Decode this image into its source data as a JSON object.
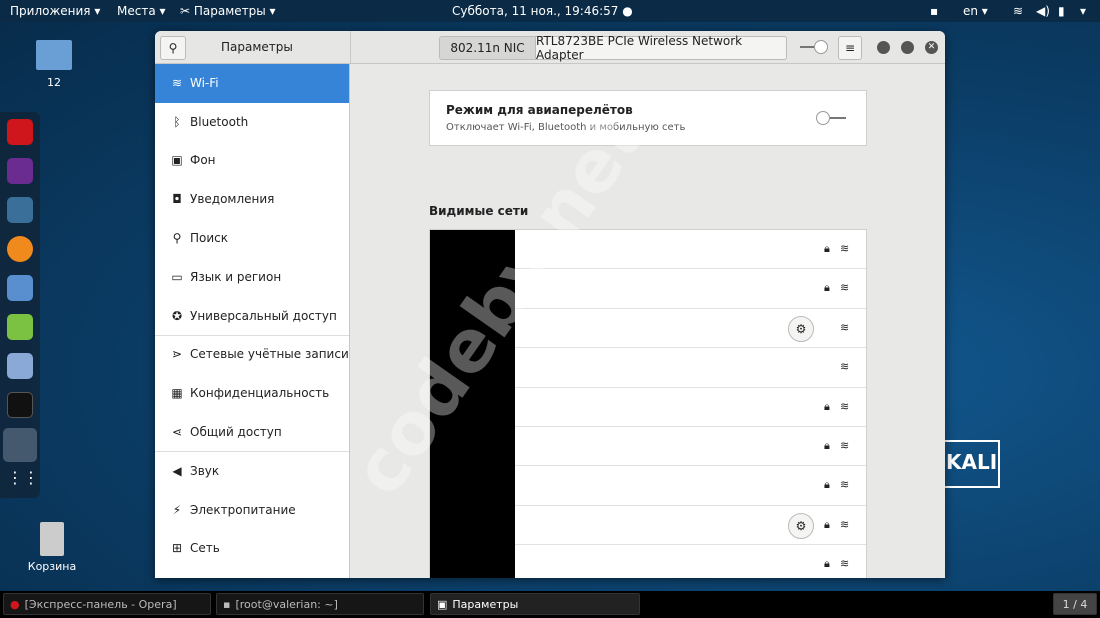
{
  "topbar": {
    "apps": "Приложения ▾",
    "places": "Места ▾",
    "settings": "Параметры ▾",
    "clock": "Суббота, 11 ноя., 19:46:57 ●",
    "lang": "en ▾"
  },
  "desktop": {
    "folder_label": "12",
    "trash_label": "Корзина"
  },
  "watermark": "codeby.net",
  "kali_logo": "KALI",
  "window": {
    "title": "Параметры",
    "tab_active": "802.11n NIC",
    "tab_other": "RTL8723BE PCIe Wireless Network Adapter",
    "sidebar": [
      {
        "icon": "wifi-icon",
        "glyph": "≋",
        "label": "Wi-Fi"
      },
      {
        "icon": "bluetooth-icon",
        "glyph": "ᛒ",
        "label": "Bluetooth"
      },
      {
        "icon": "background-icon",
        "glyph": "▣",
        "label": "Фон"
      },
      {
        "icon": "notifications-icon",
        "glyph": "◘",
        "label": "Уведомления"
      },
      {
        "icon": "search-icon",
        "glyph": "⚲",
        "label": "Поиск"
      },
      {
        "icon": "region-icon",
        "glyph": "▭",
        "label": "Язык и регион"
      },
      {
        "icon": "accessibility-icon",
        "glyph": "✪",
        "label": "Универсальный доступ"
      },
      {
        "icon": "online-accounts-icon",
        "glyph": "⋗",
        "label": "Сетевые учётные записи"
      },
      {
        "icon": "privacy-icon",
        "glyph": "▦",
        "label": "Конфиденциальность"
      },
      {
        "icon": "sharing-icon",
        "glyph": "⋖",
        "label": "Общий доступ"
      },
      {
        "icon": "sound-icon",
        "glyph": "◀",
        "label": "Звук"
      },
      {
        "icon": "power-icon",
        "glyph": "⚡",
        "label": "Электропитание"
      },
      {
        "icon": "network-icon",
        "glyph": "⊞",
        "label": "Сеть"
      }
    ],
    "airplane": {
      "title": "Режим для авиаперелётов",
      "subtitle": "Отключает Wi-Fi, Bluetooth и мобильную сеть",
      "enabled": false
    },
    "networks_heading": "Видимые сети",
    "networks": [
      {
        "gear": false,
        "lock": true
      },
      {
        "gear": false,
        "lock": true
      },
      {
        "gear": true,
        "lock": false
      },
      {
        "gear": false,
        "lock": false
      },
      {
        "gear": false,
        "lock": true
      },
      {
        "gear": false,
        "lock": true
      },
      {
        "gear": false,
        "lock": true
      },
      {
        "gear": true,
        "lock": true
      },
      {
        "gear": false,
        "lock": true
      },
      {
        "gear": true,
        "lock": true
      }
    ]
  },
  "taskbar": {
    "items": [
      "[Экспресс-панель - Opera]",
      "[root@valerian: ~]",
      "Параметры"
    ],
    "workspace": "1 / 4"
  },
  "colors": {
    "accent": "#3584d7"
  }
}
